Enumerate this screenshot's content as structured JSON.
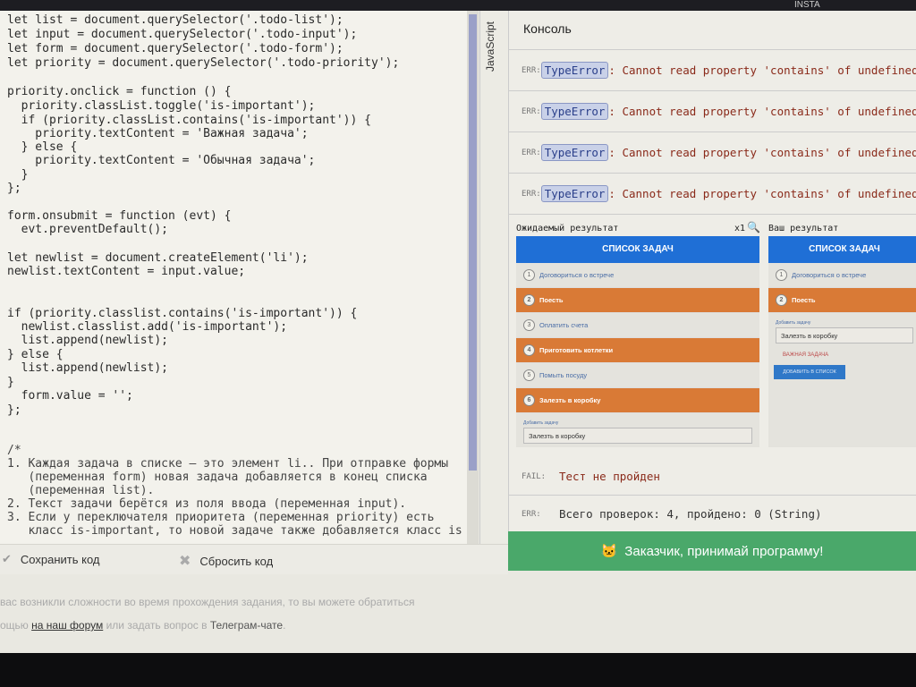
{
  "topbar": {
    "insta": "INSTA"
  },
  "editor": {
    "code_lines": [
      "let list = document.querySelector('.todo-list');",
      "let input = document.querySelector('.todo-input');",
      "let form = document.querySelector('.todo-form');",
      "let priority = document.querySelector('.todo-priority');",
      "",
      "priority.onclick = function () {",
      "  priority.classList.toggle('is-important');",
      "  if (priority.classList.contains('is-important')) {",
      "    priority.textContent = 'Важная задача';",
      "  } else {",
      "    priority.textContent = 'Обычная задача';",
      "  }",
      "};",
      "",
      "form.onsubmit = function (evt) {",
      "  evt.preventDefault();",
      "",
      "let newlist = document.createElement('li');",
      "newlist.textContent = input.value;",
      "",
      "",
      "if (priority.classlist.contains('is-important')) {",
      "  newlist.classlist.add('is-important');",
      "  list.append(newlist);",
      "} else {",
      "  list.append(newlist);",
      "}",
      "  form.value = '';",
      "};",
      "",
      "",
      "/*",
      "1. Каждая задача в списке — это элемент li.. При отправке формы",
      "   (переменная form) новая задача добавляется в конец списка",
      "   (переменная list).",
      "2. Текст задачи берётся из поля ввода (переменная input).",
      "3. Если у переключателя приоритета (переменная priority) есть",
      "   класс is-important, то новой задаче также добавляется класс is"
    ],
    "tab_label": "JavaScript",
    "save_label": "Сохранить код",
    "reset_label": "Сбросить код"
  },
  "console": {
    "title": "Консоль",
    "errors": [
      {
        "label": "ERR:",
        "type": "TypeError",
        "message": ": Cannot read property 'contains' of undefined"
      },
      {
        "label": "ERR:",
        "type": "TypeError",
        "message": ": Cannot read property 'contains' of undefined"
      },
      {
        "label": "ERR:",
        "type": "TypeError",
        "message": ": Cannot read property 'contains' of undefined"
      },
      {
        "label": "ERR:",
        "type": "TypeError",
        "message": ": Cannot read property 'contains' of undefined"
      }
    ],
    "expected_label": "Ожидаемый результат",
    "zoom_label": "x1",
    "yours_label": "Ваш результат",
    "expected": {
      "header": "СПИСОК ЗАДАЧ",
      "tasks": [
        {
          "n": "1",
          "text": "Договориться о встрече",
          "important": false
        },
        {
          "n": "2",
          "text": "Поесть",
          "important": true
        },
        {
          "n": "3",
          "text": "Оплатить счета",
          "important": false
        },
        {
          "n": "4",
          "text": "Приготовить котлетки",
          "important": true
        },
        {
          "n": "5",
          "text": "Помыть посуду",
          "important": false
        },
        {
          "n": "6",
          "text": "Залезть в коробку",
          "important": true
        }
      ],
      "input_label": "Добавить задачу",
      "input_value": "Залезть в коробку"
    },
    "yours": {
      "header": "СПИСОК ЗАДАЧ",
      "tasks": [
        {
          "n": "1",
          "text": "Договориться о встрече",
          "important": false
        },
        {
          "n": "2",
          "text": "Поесть",
          "important": true
        }
      ],
      "input_label": "Добавить задачу",
      "input_value": "Залезть в коробку",
      "priority_label": "ВАЖНАЯ ЗАДАЧА",
      "add_button": "ДОБАВИТЬ В СПИСОК"
    },
    "fail_label": "FAIL:",
    "fail_text": "Тест не пройден",
    "summary_label": "ERR:",
    "summary_text": "Всего проверок: 4, пройдено: 0 (String)",
    "submit_label": "Заказчик, принимай программу!"
  },
  "footer": {
    "line1": "вас возникли сложности во время прохождения задания, то вы можете обратиться",
    "line2_prefix": "ощью ",
    "forum_link": "на наш форум",
    "line2_mid": " или задать вопрос в ",
    "telegram_link": "Телеграм-чате",
    "line2_end": "."
  }
}
